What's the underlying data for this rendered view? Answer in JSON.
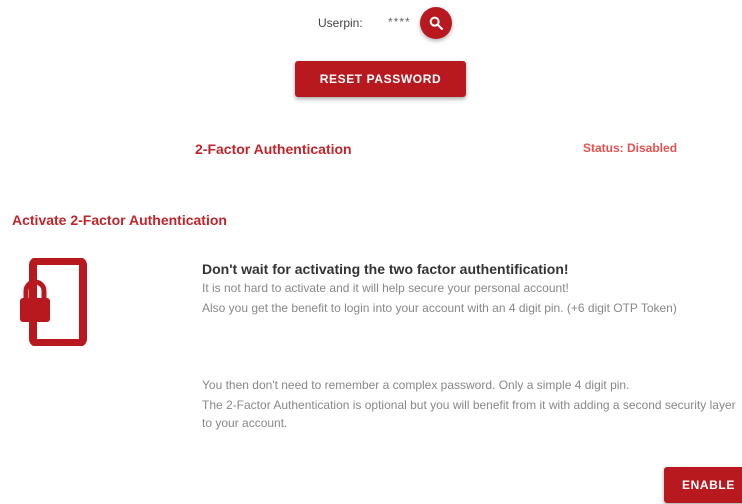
{
  "userpin": {
    "label": "Userpin:",
    "value": "****"
  },
  "buttons": {
    "reset_password": "RESET PASSWORD",
    "enable": "ENABLE"
  },
  "two_factor": {
    "title": "2-Factor Authentication",
    "status": "Status: Disabled",
    "section_title": "Activate 2-Factor Authentication"
  },
  "description": {
    "heading": "Don't wait for activating the two factor authentification!",
    "line1": "It is not hard to activate and it will help secure your personal account!",
    "line2": "Also you get the benefit to login into your account with an 4 digit pin. (+6 digit OTP Token)",
    "line3": "You then don't need to remember a complex password. Only a simple 4 digit pin.",
    "line4": "The 2-Factor Authentication is optional but you will benefit from it with adding a second security layer to your account."
  },
  "icons": {
    "search": "search-icon",
    "phone_lock": "phone-lock-icon"
  },
  "colors": {
    "primary": "#b8191f",
    "heading_red": "#c0252b",
    "status_red": "#e8504f",
    "muted_text": "#888888"
  }
}
